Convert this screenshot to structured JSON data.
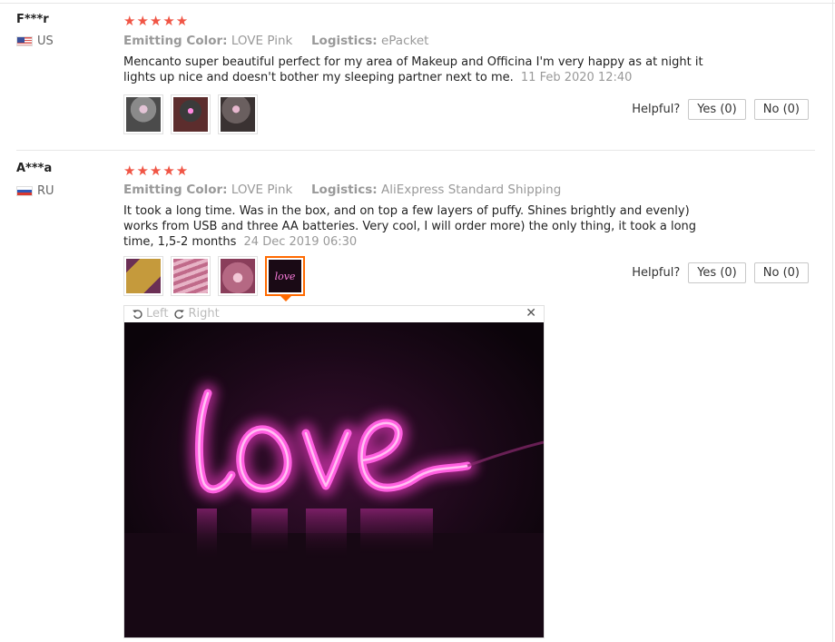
{
  "reviews": [
    {
      "user": "F***r",
      "country": "US",
      "stars": "★★★★★",
      "meta": {
        "color_key": "Emitting Color:",
        "color_val": "LOVE Pink",
        "log_key": "Logistics:",
        "log_val": "ePacket"
      },
      "text": "Mencanto super beautiful perfect for my area of Makeup and Officina I'm very happy as at night it lights up nice and doesn't bother my sleeping partner next to me.",
      "date": "11 Feb 2020 12:40",
      "helpful": "Helpful?",
      "yes": "Yes (0)",
      "no": "No (0)"
    },
    {
      "user": "A***a",
      "country": "RU",
      "stars": "★★★★★",
      "meta": {
        "color_key": "Emitting Color:",
        "color_val": "LOVE Pink",
        "log_key": "Logistics:",
        "log_val": "AliExpress Standard Shipping"
      },
      "text": "It took a long time. Was in the box, and on top a few layers of puffy. Shines brightly and evenly) works from USB and three AA batteries. Very cool, I will order more) the only thing, it took a long time, 1,5-2 months",
      "date": "24 Dec 2019 06:30",
      "helpful": "Helpful?",
      "yes": "Yes (0)",
      "no": "No (0)"
    }
  ],
  "viewer": {
    "left": "Left",
    "right": "Right",
    "close": "✕",
    "sign_text": "love"
  },
  "colors": {
    "star": "#f05545",
    "accent": "#ff6a00",
    "neon": "#ff3cd2"
  },
  "icons": {
    "rotate_left": "rotate-left-icon",
    "rotate_right": "rotate-right-icon",
    "close": "close-icon"
  }
}
